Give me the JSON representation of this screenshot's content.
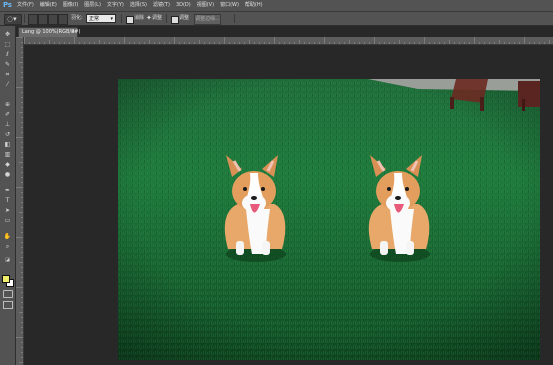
{
  "app": {
    "logo": "Ps"
  },
  "menu": [
    "文件(F)",
    "编辑(E)",
    "图像(I)",
    "图层(L)",
    "文字(Y)",
    "选择(S)",
    "滤镜(T)",
    "3D(D)",
    "视图(V)",
    "窗口(W)",
    "帮助(H)"
  ],
  "options": {
    "feather_label": "羽化:",
    "mode_value": "正常",
    "antialias_label": "消除",
    "blend_label": "调整",
    "refine_label": "调整边缘..."
  },
  "document": {
    "tab_title": "Lang @ 100%(RGB/8#)",
    "close": "×"
  },
  "colors": {
    "foreground": "#f0ee6a",
    "background": "#ffffff",
    "ui_panel": "#535353",
    "workspace": "#282828"
  },
  "toolbar": [
    "move-icon",
    "marquee-icon",
    "lasso-icon",
    "quick-select-icon",
    "crop-icon",
    "eyedropper-icon",
    "healing-icon",
    "brush-icon",
    "stamp-icon",
    "history-brush-icon",
    "eraser-icon",
    "gradient-icon",
    "blur-icon",
    "dodge-icon",
    "pen-icon",
    "type-icon",
    "path-select-icon",
    "shape-icon",
    "hand-icon",
    "zoom-icon"
  ]
}
